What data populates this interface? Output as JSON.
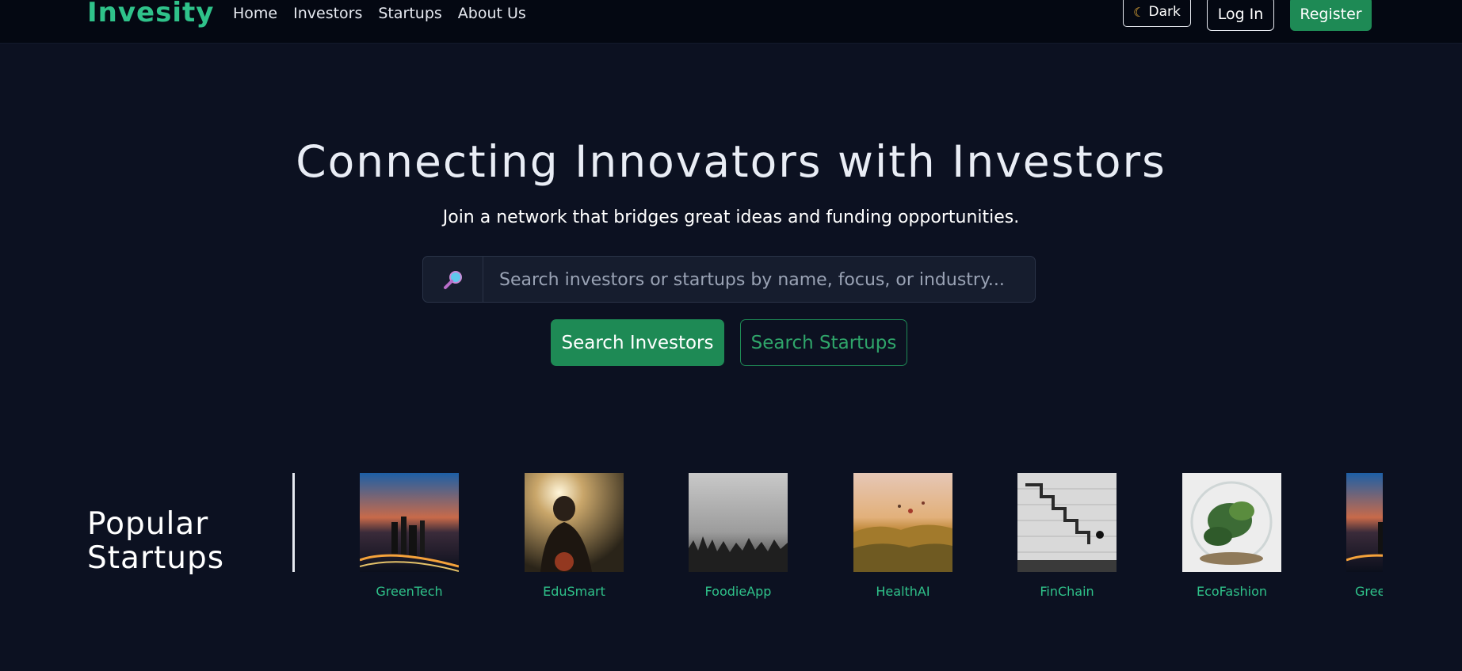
{
  "brand": {
    "name": "Invesity"
  },
  "nav": {
    "links": [
      "Home",
      "Investors",
      "Startups",
      "About Us"
    ],
    "theme_toggle": "Dark",
    "login": "Log In",
    "register": "Register"
  },
  "hero": {
    "title": "Connecting Innovators with Investors",
    "subtitle": "Join a network that bridges great ideas and funding opportunities.",
    "search": {
      "placeholder": "Search investors or startups by name, focus, or industry...",
      "value": ""
    },
    "btn_investors": "Search Investors",
    "btn_startups": "Search Startups"
  },
  "popular": {
    "title": "Popular Startups",
    "startups": [
      {
        "name": "GreenTech",
        "image": "city-sunset"
      },
      {
        "name": "EduSmart",
        "image": "person-backlit"
      },
      {
        "name": "FoodieApp",
        "image": "foggy-forest"
      },
      {
        "name": "HealthAI",
        "image": "hot-air-balloons"
      },
      {
        "name": "FinChain",
        "image": "stone-stairs-cat"
      },
      {
        "name": "EcoFashion",
        "image": "terrarium"
      },
      {
        "name": "GreenTech",
        "image": "city-sunset"
      }
    ]
  },
  "colors": {
    "accent": "#1e8a55",
    "brand": "#2fc28a",
    "background": "#0c1121",
    "navbar": "#040812"
  }
}
